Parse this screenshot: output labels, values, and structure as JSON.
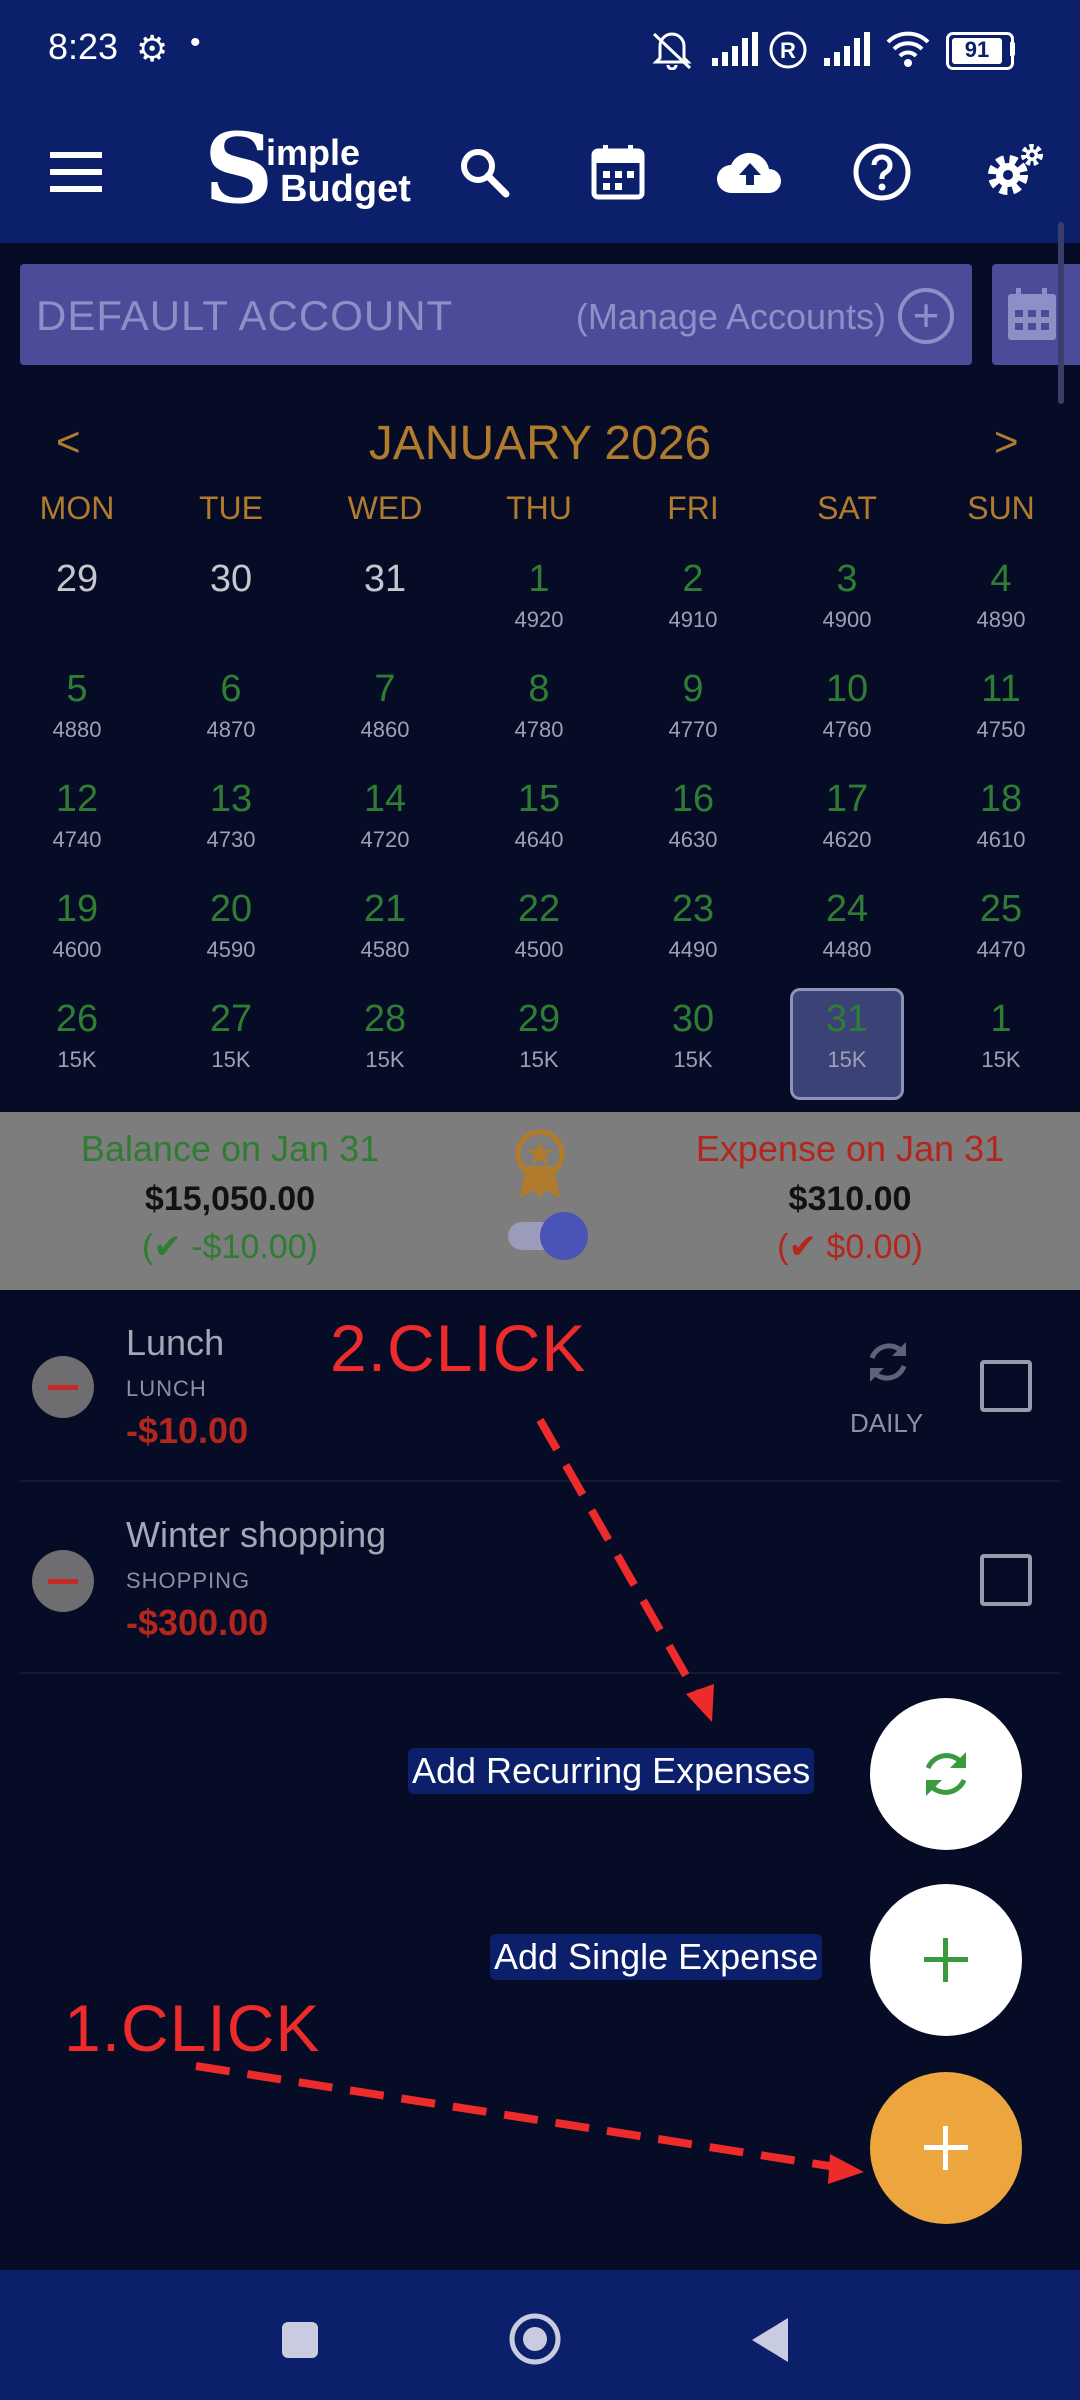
{
  "status_bar": {
    "time": "8:23",
    "battery": "91"
  },
  "app": {
    "logo_big": "S",
    "logo_line1": "imple",
    "logo_line2": "Budget"
  },
  "account": {
    "name": "DEFAULT ACCOUNT",
    "manage_label": "(Manage Accounts)",
    "add_symbol": "+"
  },
  "calendar": {
    "prev": "<",
    "next": ">",
    "month": "JANUARY 2026",
    "days_of_week": [
      "MON",
      "TUE",
      "WED",
      "THU",
      "FRI",
      "SAT",
      "SUN"
    ],
    "weeks": [
      [
        {
          "d": "29",
          "v": ""
        },
        {
          "d": "30",
          "v": ""
        },
        {
          "d": "31",
          "v": ""
        },
        {
          "d": "1",
          "v": "4920"
        },
        {
          "d": "2",
          "v": "4910"
        },
        {
          "d": "3",
          "v": "4900"
        },
        {
          "d": "4",
          "v": "4890"
        }
      ],
      [
        {
          "d": "5",
          "v": "4880"
        },
        {
          "d": "6",
          "v": "4870"
        },
        {
          "d": "7",
          "v": "4860"
        },
        {
          "d": "8",
          "v": "4780"
        },
        {
          "d": "9",
          "v": "4770"
        },
        {
          "d": "10",
          "v": "4760"
        },
        {
          "d": "11",
          "v": "4750"
        }
      ],
      [
        {
          "d": "12",
          "v": "4740"
        },
        {
          "d": "13",
          "v": "4730"
        },
        {
          "d": "14",
          "v": "4720"
        },
        {
          "d": "15",
          "v": "4640"
        },
        {
          "d": "16",
          "v": "4630"
        },
        {
          "d": "17",
          "v": "4620"
        },
        {
          "d": "18",
          "v": "4610"
        }
      ],
      [
        {
          "d": "19",
          "v": "4600"
        },
        {
          "d": "20",
          "v": "4590"
        },
        {
          "d": "21",
          "v": "4580"
        },
        {
          "d": "22",
          "v": "4500"
        },
        {
          "d": "23",
          "v": "4490"
        },
        {
          "d": "24",
          "v": "4480"
        },
        {
          "d": "25",
          "v": "4470"
        }
      ],
      [
        {
          "d": "26",
          "v": "15K"
        },
        {
          "d": "27",
          "v": "15K"
        },
        {
          "d": "28",
          "v": "15K"
        },
        {
          "d": "29",
          "v": "15K"
        },
        {
          "d": "30",
          "v": "15K"
        },
        {
          "d": "31",
          "v": "15K"
        },
        {
          "d": "1",
          "v": "15K"
        }
      ]
    ]
  },
  "summary": {
    "balance_title": "Balance on Jan 31",
    "balance_amount": "$15,050.00",
    "balance_sub": "(✔ -$10.00)",
    "expense_title": "Expense on Jan 31",
    "expense_amount": "$310.00",
    "expense_sub": "(✔ $0.00)"
  },
  "expenses": [
    {
      "title": "Lunch",
      "category": "LUNCH",
      "amount": "-$10.00",
      "recurrence": "DAILY"
    },
    {
      "title": "Winter shopping",
      "category": "SHOPPING",
      "amount": "-$300.00"
    }
  ],
  "fab": {
    "recurring_label": "Add Recurring Expenses",
    "single_label": "Add Single Expense"
  },
  "annotations": {
    "step1": "1.CLICK",
    "step2": "2.CLICK"
  },
  "colors": {
    "header": "#0b1f6a",
    "accent_orange": "#eda53d",
    "green": "#2f7d33",
    "red": "#b3261e"
  }
}
